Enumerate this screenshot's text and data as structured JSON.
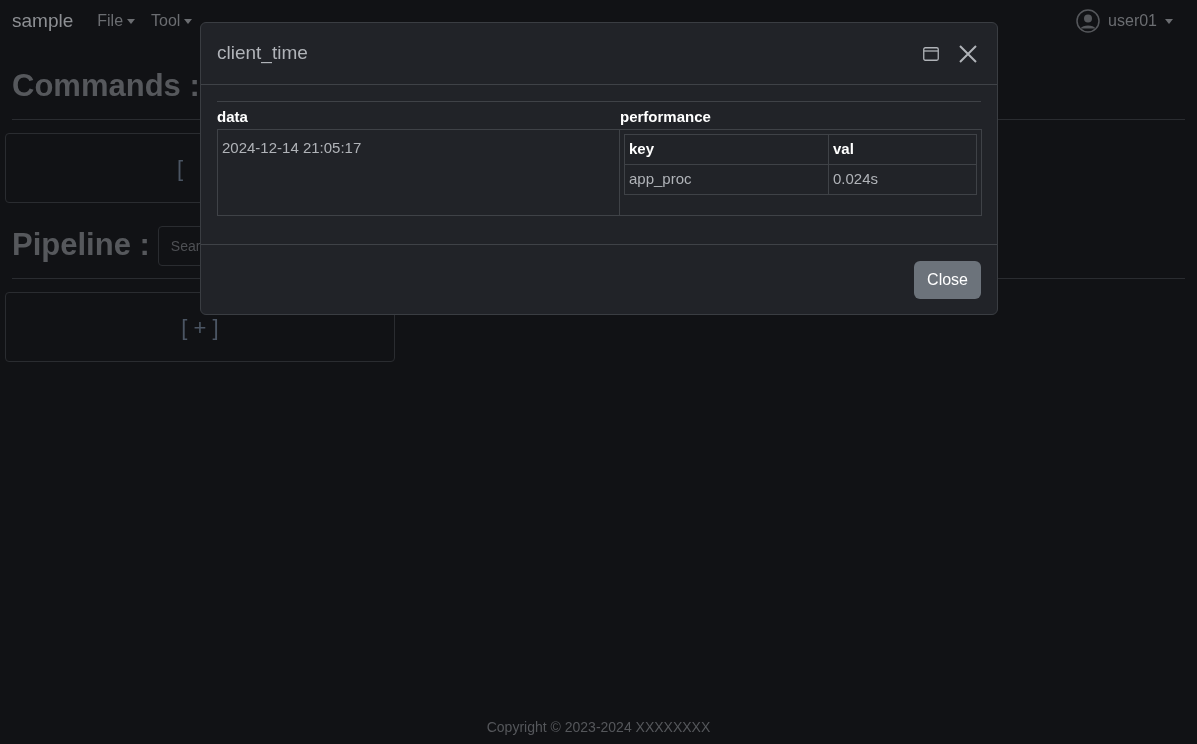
{
  "navbar": {
    "brand": "sample",
    "menus": [
      {
        "label": "File"
      },
      {
        "label": "Tool"
      }
    ],
    "user": "user01"
  },
  "sections": [
    {
      "title": "Commands :",
      "card_text": "["
    },
    {
      "title": "Pipeline :",
      "search": {
        "placeholder": "Sear"
      },
      "card_text": "[ + ]"
    }
  ],
  "footer": "Copyright © 2023-2024 XXXXXXXX",
  "modal": {
    "title": "client_time",
    "table": {
      "columns": [
        "data",
        "performance"
      ],
      "data_value": "2024-12-14 21:05:17",
      "performance": {
        "columns": [
          "key",
          "val"
        ],
        "rows": [
          [
            "app_proc",
            "0.024s"
          ]
        ]
      }
    },
    "close_button": "Close"
  }
}
